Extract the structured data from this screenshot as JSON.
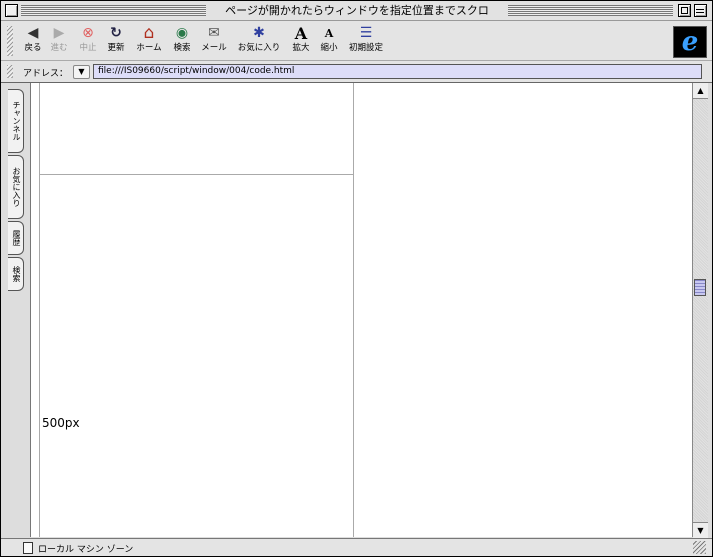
{
  "window": {
    "title": "ページが開かれたらウィンドウを指定位置までスクロ"
  },
  "toolbar": {
    "buttons": [
      {
        "label": "戻る",
        "icon": "back-arrow-icon",
        "glyph": "◀"
      },
      {
        "label": "進む",
        "icon": "forward-arrow-icon",
        "glyph": "▶",
        "disabled": true
      },
      {
        "label": "中止",
        "icon": "stop-icon",
        "glyph": "⊗",
        "disabled": true
      },
      {
        "label": "更新",
        "icon": "refresh-icon",
        "glyph": "↻"
      },
      {
        "label": "ホーム",
        "icon": "home-icon",
        "glyph": "⌂"
      },
      {
        "label": "検索",
        "icon": "search-icon",
        "glyph": "◉"
      },
      {
        "label": "メール",
        "icon": "mail-icon",
        "glyph": "✉"
      },
      {
        "label": "お気に入り",
        "icon": "favorites-icon",
        "glyph": "✱"
      },
      {
        "label": "拡大",
        "icon": "text-larger-icon",
        "glyph": "A"
      },
      {
        "label": "縮小",
        "icon": "text-smaller-icon",
        "glyph": "A"
      },
      {
        "label": "初期設定",
        "icon": "preferences-icon",
        "glyph": "☰"
      }
    ]
  },
  "address": {
    "label": "アドレス：",
    "url": "file:///IS09660/script/window/004/code.html"
  },
  "explorer_tabs": [
    "チャンネル",
    "お気に入り",
    "履歴",
    "検索"
  ],
  "content": {
    "size_label": "500px"
  },
  "status": {
    "zone": "ローカル マシン ゾーン"
  }
}
